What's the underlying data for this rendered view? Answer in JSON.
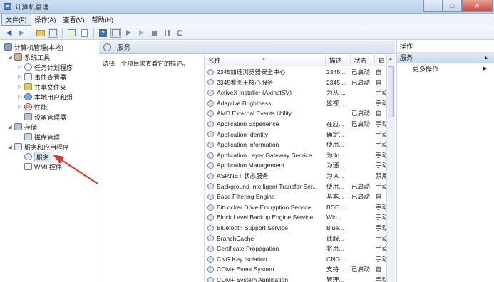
{
  "window": {
    "title": "计算机管理",
    "minimize": "─",
    "maximize": "□",
    "close": "✕"
  },
  "menu": [
    "文件(F)",
    "操作(A)",
    "查看(V)",
    "帮助(H)"
  ],
  "tree": {
    "root": "计算机管理(本地)",
    "system_tools": "系统工具",
    "task_scheduler": "任务计划程序",
    "event_viewer": "事件查看器",
    "shared_folders": "共享文件夹",
    "local_users": "本地用户和组",
    "performance": "性能",
    "device_manager": "设备管理器",
    "storage": "存储",
    "disk_management": "磁盘管理",
    "services_apps": "服务和应用程序",
    "services": "服务",
    "wmi": "WMI 控件"
  },
  "center": {
    "title": "服务",
    "description_hint": "选择一个项目来查看它的描述。"
  },
  "table": {
    "columns": [
      "名称",
      "描述",
      "状态",
      "启"
    ],
    "rows": [
      {
        "name": "2345加速浏览器安全中心",
        "desc": "2345...",
        "status": "已启动",
        "startup": "自"
      },
      {
        "name": "2345看图王核心服务",
        "desc": "2345...",
        "status": "已启动",
        "startup": "自"
      },
      {
        "name": "ActiveX Installer (AxInstSV)",
        "desc": "为从 ...",
        "status": "",
        "startup": "手动"
      },
      {
        "name": "Adaptive Brightness",
        "desc": "监视...",
        "status": "",
        "startup": "手动"
      },
      {
        "name": "AMD External Events Utility",
        "desc": "",
        "status": "已启动",
        "startup": "自"
      },
      {
        "name": "Application Experience",
        "desc": "在应...",
        "status": "已启动",
        "startup": "手动"
      },
      {
        "name": "Application Identity",
        "desc": "确定...",
        "status": "",
        "startup": "手动"
      },
      {
        "name": "Application Information",
        "desc": "使用...",
        "status": "",
        "startup": "手动"
      },
      {
        "name": "Application Layer Gateway Service",
        "desc": "为 In...",
        "status": "",
        "startup": "手动"
      },
      {
        "name": "Application Management",
        "desc": "为通...",
        "status": "",
        "startup": "手动"
      },
      {
        "name": "ASP.NET 状态服务",
        "desc": "为 A...",
        "status": "",
        "startup": "禁用"
      },
      {
        "name": "Background Intelligent Transfer Ser...",
        "desc": "使用...",
        "status": "已启动",
        "startup": "手动"
      },
      {
        "name": "Base Filtering Engine",
        "desc": "基本...",
        "status": "已启动",
        "startup": "自"
      },
      {
        "name": "BitLocker Drive Encryption Service",
        "desc": "BDE...",
        "status": "",
        "startup": "手动"
      },
      {
        "name": "Block Level Backup Engine Service",
        "desc": "Win...",
        "status": "",
        "startup": "手动"
      },
      {
        "name": "Bluetooth Support Service",
        "desc": "Blue...",
        "status": "",
        "startup": "手动"
      },
      {
        "name": "BranchCache",
        "desc": "此服...",
        "status": "",
        "startup": "手动"
      },
      {
        "name": "Certificate Propagation",
        "desc": "将用...",
        "status": "",
        "startup": "手动"
      },
      {
        "name": "CNG Key Isolation",
        "desc": "CNG...",
        "status": "",
        "startup": "手动"
      },
      {
        "name": "COM+ Event System",
        "desc": "支持...",
        "status": "已启动",
        "startup": "自"
      },
      {
        "name": "COM+ System Application",
        "desc": "管理...",
        "status": "",
        "startup": "手动"
      }
    ]
  },
  "actions": {
    "header": "操作",
    "section": "服务",
    "more": "更多操作"
  },
  "accent_color": "#d9392b"
}
